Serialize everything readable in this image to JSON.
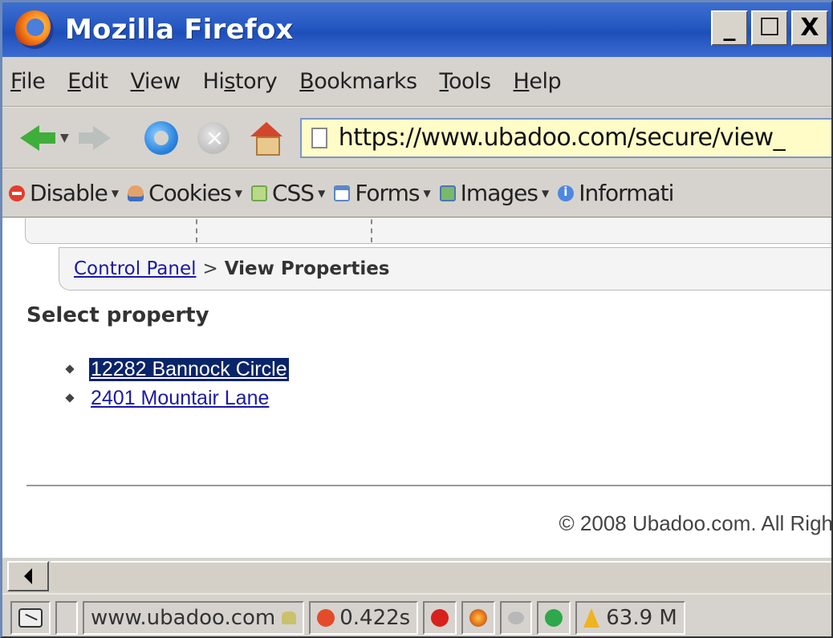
{
  "window": {
    "title": "Mozilla Firefox",
    "controls": {
      "minimize": "_",
      "maximize": "☐",
      "close": "X"
    }
  },
  "menu": {
    "items": [
      {
        "label": "File",
        "accel": "F"
      },
      {
        "label": "Edit",
        "accel": "E"
      },
      {
        "label": "View",
        "accel": "V"
      },
      {
        "label": "History",
        "accel": "s"
      },
      {
        "label": "Bookmarks",
        "accel": "B"
      },
      {
        "label": "Tools",
        "accel": "T"
      },
      {
        "label": "Help",
        "accel": "H"
      }
    ]
  },
  "navbar": {
    "url": "https://www.ubadoo.com/secure/view_"
  },
  "devbar": {
    "items": [
      {
        "label": "Disable",
        "icon": "disable-icon"
      },
      {
        "label": "Cookies",
        "icon": "cookies-icon"
      },
      {
        "label": "CSS",
        "icon": "css-icon"
      },
      {
        "label": "Forms",
        "icon": "forms-icon"
      },
      {
        "label": "Images",
        "icon": "images-icon"
      },
      {
        "label": "Informati",
        "icon": "information-icon"
      }
    ]
  },
  "page": {
    "breadcrumb": {
      "link": "Control Panel",
      "separator": ">",
      "current": "View Properties"
    },
    "heading": "Select property",
    "properties": [
      {
        "label": "12282 Bannock Circle",
        "selected": true
      },
      {
        "label": "2401 Mountair Lane",
        "selected": false
      }
    ],
    "footer": "© 2008 Ubadoo.com. All Righ"
  },
  "statusbar": {
    "domain": "www.ubadoo.com",
    "load_time": "0.422s",
    "memory": "63.9 M"
  },
  "colors": {
    "titlebar": "#2557c2",
    "link": "#1a1aa6",
    "selection": "#0a246a",
    "url_background": "#fffcc8"
  }
}
